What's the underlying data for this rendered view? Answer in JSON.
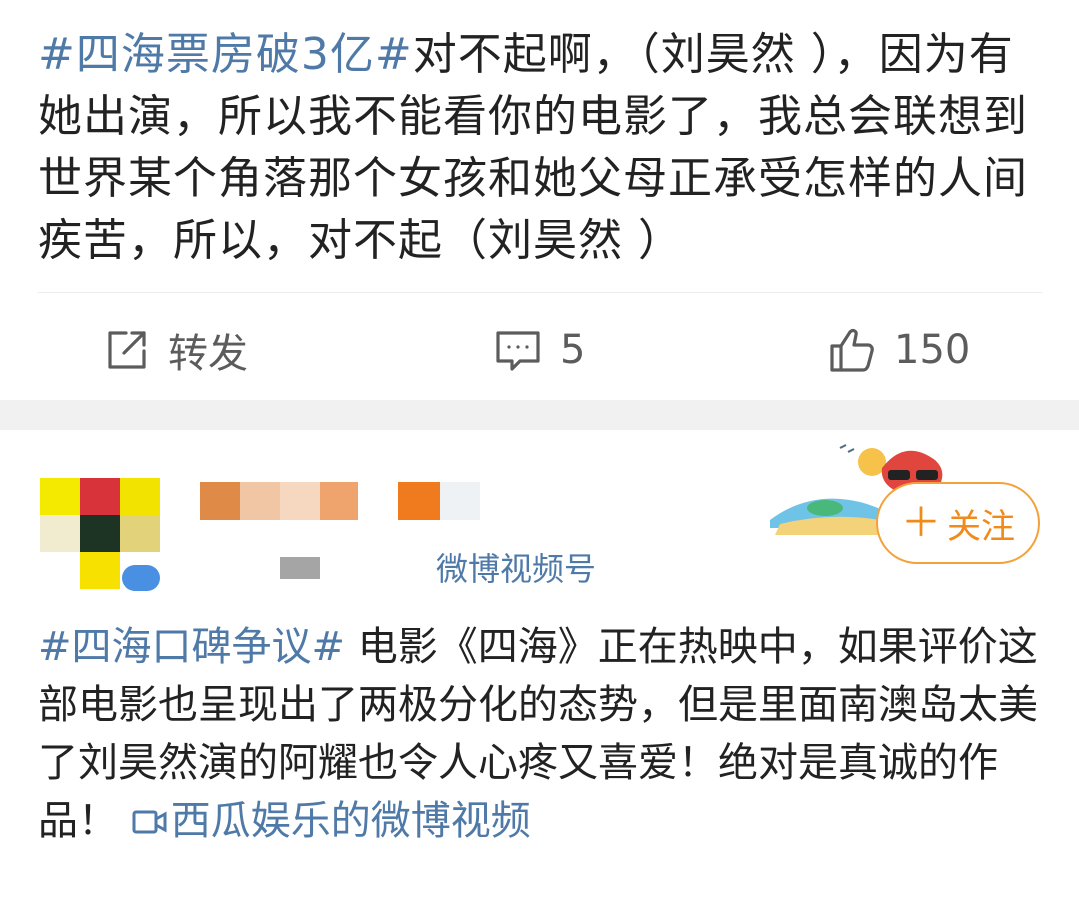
{
  "post1": {
    "tag": "#四海票房破3亿#",
    "body": "对不起啊，（刘昊然 ），因为有她出演，所以我不能看你的电影了，我总会联想到世界某个角落那个女孩和她父母正承受怎样的人间疾苦，所以，对不起（刘昊然 ）",
    "actions": {
      "repost_label": "转发",
      "comment_count": "5",
      "like_count": "150"
    }
  },
  "post2": {
    "source_label": "微博视频号",
    "follow_label": "关注",
    "follow_plus": "＋",
    "tag": "#四海口碑争议#",
    "body": " 电影《四海》正在热映中，如果评价这部电影也呈现出了两极分化的态势，但是里面南澳岛太美了刘昊然演的阿耀也令人心疼又喜爱！绝对是真诚的作品！ ",
    "video_link": "西瓜娱乐的微博视频"
  },
  "colors": {
    "tag": "#4f7aa8",
    "follow": "#f08a1b",
    "icon": "#5c5c5c"
  }
}
